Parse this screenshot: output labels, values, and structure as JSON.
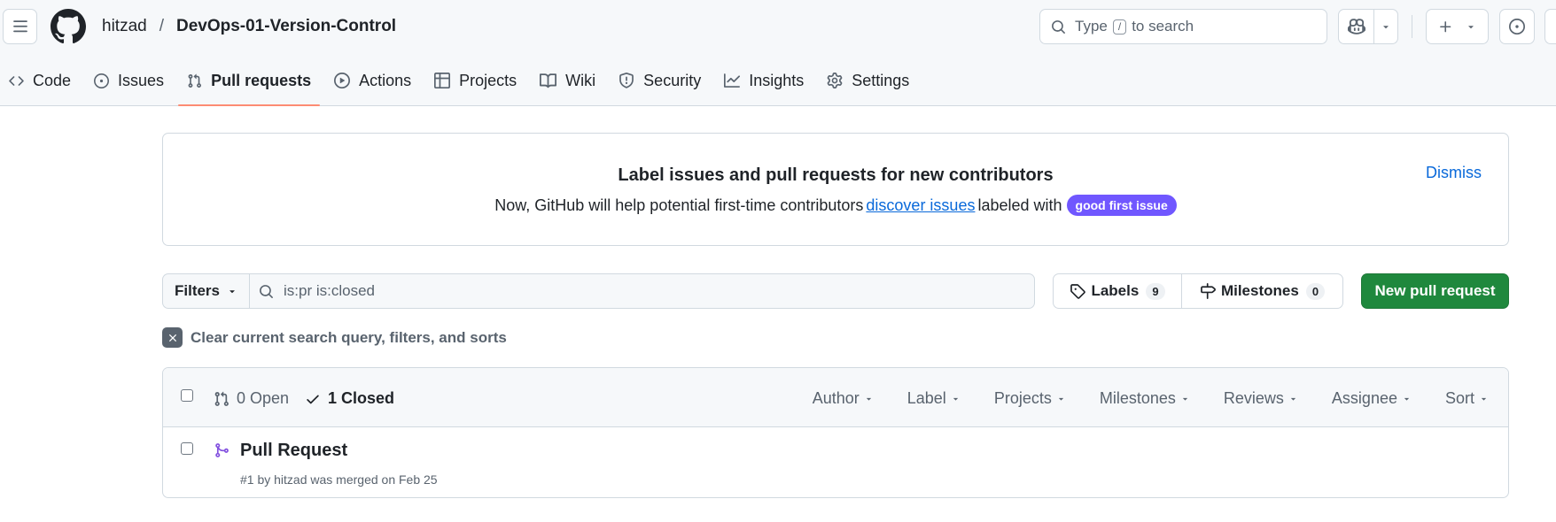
{
  "header": {
    "owner": "hitzad",
    "separator": "/",
    "repo": "DevOps-01-Version-Control",
    "search_before": "Type",
    "search_key": "/",
    "search_after": "to search"
  },
  "tabs": [
    {
      "label": "Code",
      "icon": "code-icon"
    },
    {
      "label": "Issues",
      "icon": "issue-opened-icon"
    },
    {
      "label": "Pull requests",
      "icon": "git-pull-request-icon",
      "active": true
    },
    {
      "label": "Actions",
      "icon": "play-icon"
    },
    {
      "label": "Projects",
      "icon": "table-icon"
    },
    {
      "label": "Wiki",
      "icon": "book-icon"
    },
    {
      "label": "Security",
      "icon": "shield-icon"
    },
    {
      "label": "Insights",
      "icon": "graph-icon"
    },
    {
      "label": "Settings",
      "icon": "gear-icon"
    }
  ],
  "banner": {
    "title": "Label issues and pull requests for new contributors",
    "desc_before": "Now, GitHub will help potential first-time contributors",
    "desc_link": "discover issues",
    "desc_after": "labeled with",
    "badge": "good first issue",
    "dismiss": "Dismiss"
  },
  "filters": {
    "button": "Filters",
    "query": "is:pr is:closed",
    "labels": "Labels",
    "labels_count": "9",
    "milestones": "Milestones",
    "milestones_count": "0",
    "new_pr": "New pull request",
    "clear": "Clear current search query, filters, and sorts"
  },
  "list": {
    "open": "0 Open",
    "closed": "1 Closed",
    "sorters": [
      "Author",
      "Label",
      "Projects",
      "Milestones",
      "Reviews",
      "Assignee",
      "Sort"
    ],
    "items": [
      {
        "title": "Pull Request",
        "meta": "#1 by hitzad was merged on Feb 25"
      }
    ]
  },
  "colors": {
    "accent_underline": "#fd8c73",
    "link": "#0969da",
    "primary_button": "#1f883d",
    "badge": "#7057ff",
    "merged": "#8250df"
  }
}
